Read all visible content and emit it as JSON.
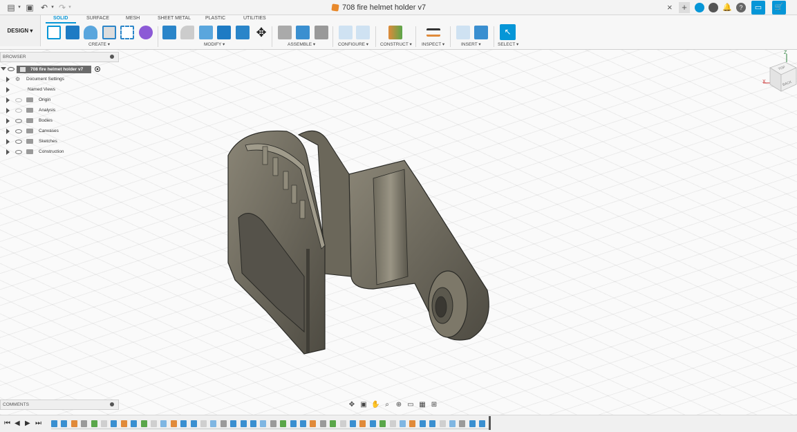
{
  "title_bar": {
    "document_title": "708 fire helmet holder v7",
    "close_glyph": "×",
    "plus_glyph": "+",
    "cart_glyph": "🛒"
  },
  "ribbon": {
    "workspace": "DESIGN ▾",
    "tabs": [
      "SOLID",
      "SURFACE",
      "MESH",
      "SHEET METAL",
      "PLASTIC",
      "UTILITIES"
    ],
    "active_tab": "SOLID",
    "groups": {
      "create": "CREATE ▾",
      "modify": "MODIFY ▾",
      "assemble": "ASSEMBLE ▾",
      "configure": "CONFIGURE ▾",
      "construct": "CONSTRUCT ▾",
      "inspect": "INSPECT ▾",
      "insert": "INSERT ▾",
      "select": "SELECT ▾"
    },
    "accent_color": "#0696d7"
  },
  "browser": {
    "header": "BROWSER",
    "root": "708 fire helmet holder v7",
    "items": [
      {
        "label": "Document Settings",
        "icon": "gear-icon"
      },
      {
        "label": "Named Views",
        "icon": "none"
      },
      {
        "label": "Origin",
        "icon": "folder-icon"
      },
      {
        "label": "Analysis",
        "icon": "folder-icon"
      },
      {
        "label": "Bodies",
        "icon": "folder-icon"
      },
      {
        "label": "Canvases",
        "icon": "folder-icon"
      },
      {
        "label": "Sketches",
        "icon": "folder-icon"
      },
      {
        "label": "Construction",
        "icon": "folder-icon"
      }
    ]
  },
  "viewcube": {
    "top_face": "TOP",
    "back_face": "BACK",
    "axis_x": "X",
    "axis_z": "Z"
  },
  "comments": {
    "header": "COMMENTS"
  },
  "timeline": {
    "play_controls": [
      "⏮",
      "◀",
      "▶",
      "⏭"
    ]
  }
}
